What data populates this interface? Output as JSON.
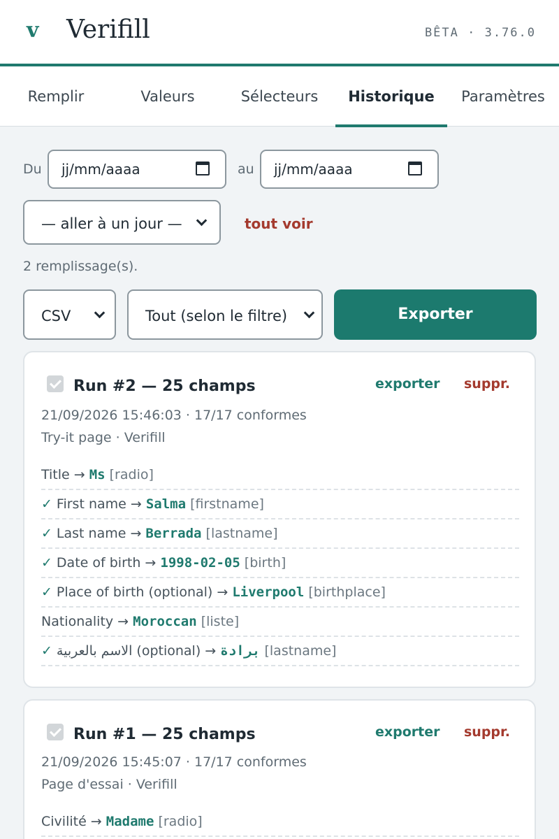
{
  "header": {
    "logo": "v",
    "title": "Verifill",
    "version": "BÊTA · 3.76.0"
  },
  "tabs": [
    "Remplir",
    "Valeurs",
    "Sélecteurs",
    "Historique",
    "Paramètres"
  ],
  "active_tab": "Historique",
  "filters": {
    "from_label": "Du",
    "to_label": "au",
    "date_placeholder": "jj/mm/aaaa",
    "day_select": "— aller à un jour —",
    "see_all": "tout voir"
  },
  "count_text": "2 remplissage(s).",
  "export": {
    "format": "CSV",
    "scope": "Tout (selon le filtre)",
    "button": "Exporter"
  },
  "runs": [
    {
      "title": "Run #2 — 25 champs",
      "export_label": "exporter",
      "delete_label": "suppr.",
      "timestamp": "21/09/2026 15:46:03 · 17/17 conformes",
      "page": "Try-it page · Verifill",
      "fields": [
        {
          "check": "",
          "label": "Title → ",
          "value": "Ms",
          "tag": " [radio]"
        },
        {
          "check": "✓",
          "label": "First name → ",
          "value": "Salma",
          "tag": " [firstname]"
        },
        {
          "check": "✓",
          "label": "Last name → ",
          "value": "Berrada",
          "tag": " [lastname]"
        },
        {
          "check": "✓",
          "label": "Date of birth → ",
          "value": "1998-02-05",
          "tag": " [birth]"
        },
        {
          "check": "✓",
          "label": "Place of birth (optional) → ",
          "value": "Liverpool",
          "tag": " [birthplace]"
        },
        {
          "check": "",
          "label": "Nationality → ",
          "value": "Moroccan",
          "tag": " [liste]"
        },
        {
          "check": "✓",
          "label": "الاسم بالعربية (optional) → ",
          "value": "برادة",
          "tag": " [lastname]"
        }
      ]
    },
    {
      "title": "Run #1 — 25 champs",
      "export_label": "exporter",
      "delete_label": "suppr.",
      "timestamp": "21/09/2026 15:45:07 · 17/17 conformes",
      "page": "Page d'essai · Verifill",
      "fields": [
        {
          "check": "",
          "label": "Civilité → ",
          "value": "Madame",
          "tag": " [radio]"
        }
      ]
    }
  ],
  "colors": {
    "accent": "#1f7a6e",
    "danger": "#a43a2e",
    "background": "#f1f4f6"
  }
}
